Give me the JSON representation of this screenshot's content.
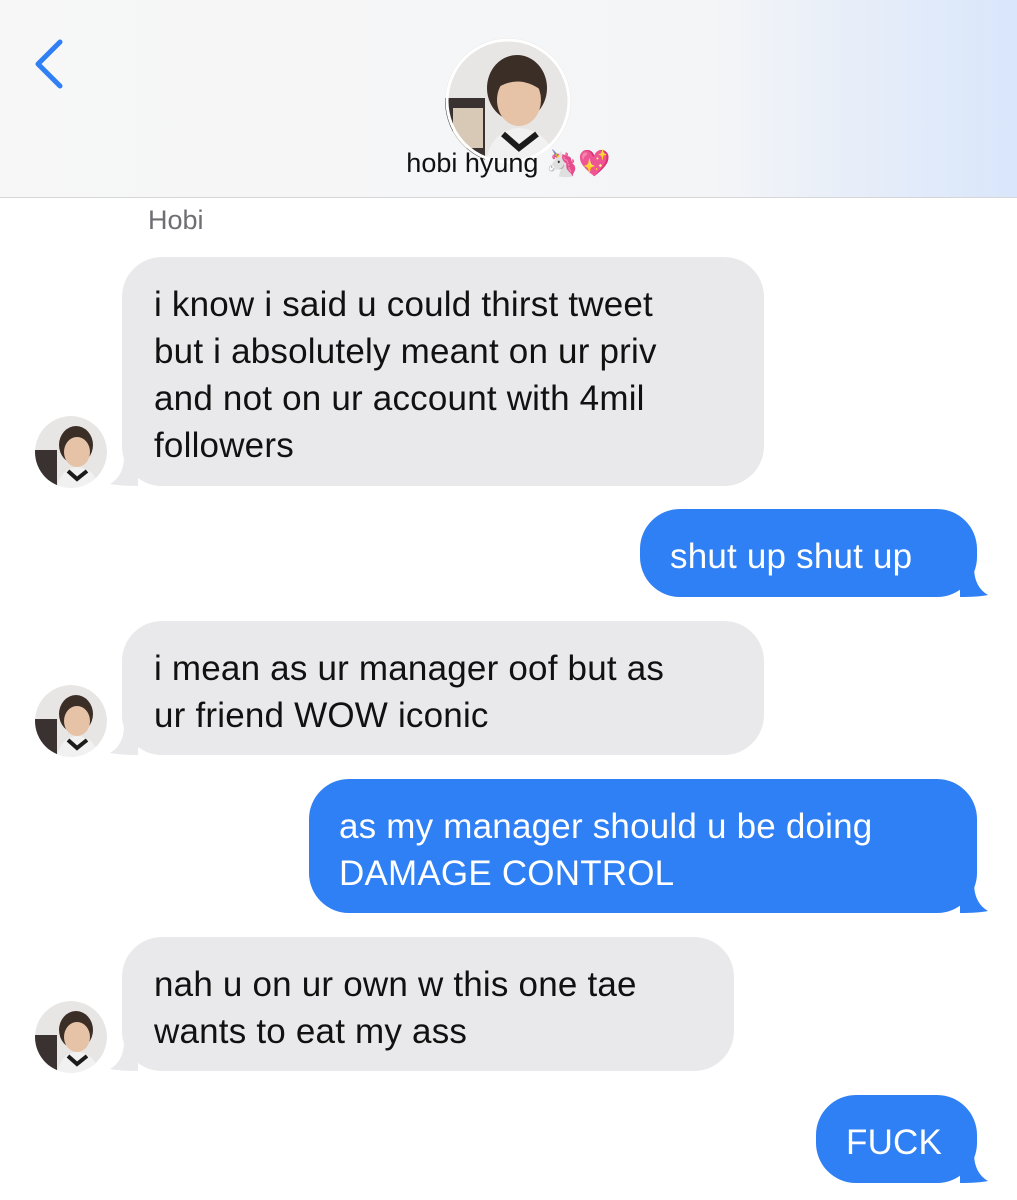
{
  "header": {
    "contact_name": "hobi hyung",
    "name_emoji_unicorn": "🦄",
    "name_emoji_heart": "💖",
    "back_icon": "chevron-left-icon"
  },
  "thread": {
    "sender_label": "Hobi",
    "messages": [
      {
        "from": "contact",
        "text": "i know i said u could thirst tweet\nbut i absolutely meant on ur priv\nand not on ur account with 4mil\nfollowers"
      },
      {
        "from": "me",
        "text": "shut up shut up"
      },
      {
        "from": "contact",
        "text": "i mean as ur manager oof but as\nur friend WOW iconic"
      },
      {
        "from": "me",
        "text": "as my manager should u be doing\nDAMAGE CONTROL"
      },
      {
        "from": "contact",
        "text": "nah u on ur own w this one tae\nwants to eat my ass"
      },
      {
        "from": "me",
        "text": "FUCK"
      }
    ]
  },
  "colors": {
    "outgoing_bubble": "#2f7ff5",
    "incoming_bubble": "#e9e9eb",
    "accent": "#2f7ff5"
  }
}
